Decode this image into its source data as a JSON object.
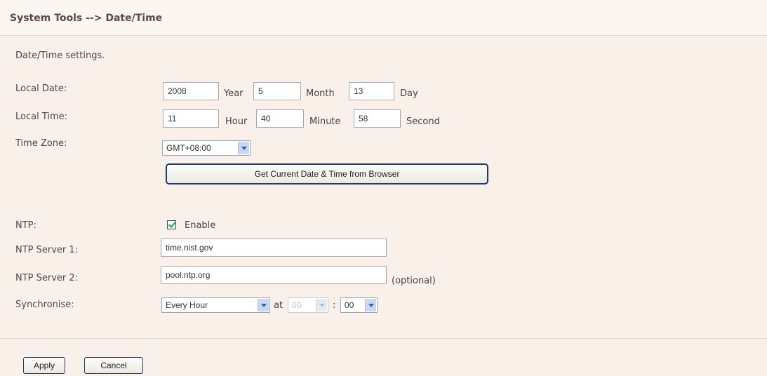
{
  "header": {
    "title": "System Tools --> Date/Time"
  },
  "description": "Date/Time settings.",
  "local_date": {
    "label": "Local Date:",
    "year": "2008",
    "year_unit": "Year",
    "month": "5",
    "month_unit": "Month",
    "day": "13",
    "day_unit": "Day"
  },
  "local_time": {
    "label": "Local Time:",
    "hour": "11",
    "hour_unit": "Hour",
    "minute": "40",
    "minute_unit": "Minute",
    "second": "58",
    "second_unit": "Second"
  },
  "time_zone": {
    "label": "Time Zone:",
    "value": "GMT+08:00"
  },
  "browser_button": "Get Current Date & Time from Browser",
  "ntp": {
    "label": "NTP:",
    "enable_label": "Enable",
    "enabled": true
  },
  "ntp_server1": {
    "label": "NTP Server 1:",
    "value": "time.nist.gov"
  },
  "ntp_server2": {
    "label": "NTP Server 2:",
    "value": "pool.ntp.org",
    "note": "(optional)"
  },
  "synchronise": {
    "label": "Synchronise:",
    "interval": "Every Hour",
    "at_label": "at",
    "hour": "00",
    "separator": ":",
    "minute": "00"
  },
  "actions": {
    "apply": "Apply",
    "cancel": "Cancel"
  }
}
